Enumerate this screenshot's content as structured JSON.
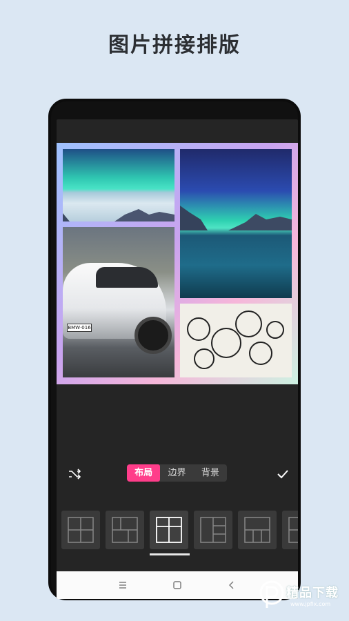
{
  "headline": "图片拼接排版",
  "toolbar": {
    "tabs": [
      {
        "label": "布局",
        "active": true
      },
      {
        "label": "边界",
        "active": false
      },
      {
        "label": "背景",
        "active": false
      }
    ],
    "shuffle_icon": "shuffle-icon",
    "confirm_icon": "check-icon"
  },
  "collage": {
    "photos": [
      "aurora-lake-landscape",
      "aurora-lake-portrait",
      "white-suv-car",
      "doodle-illustration"
    ],
    "car_plate": "BMW·016"
  },
  "layouts": [
    {
      "name": "grid-2x2",
      "selected": false
    },
    {
      "name": "grid-3-left-split",
      "selected": false
    },
    {
      "name": "grid-3-top-split",
      "selected": true
    },
    {
      "name": "grid-3-right-stack",
      "selected": false
    },
    {
      "name": "grid-4-bottom-row",
      "selected": false
    },
    {
      "name": "grid-partial",
      "selected": false
    }
  ],
  "navbar": {
    "icons": [
      "menu-icon",
      "home-icon",
      "back-icon"
    ]
  },
  "watermark": {
    "text": "精品下载",
    "url": "www.jpfix.com"
  },
  "colors": {
    "accent": "#ff3d8a",
    "background": "#dbe7f3",
    "screen": "#252525"
  }
}
